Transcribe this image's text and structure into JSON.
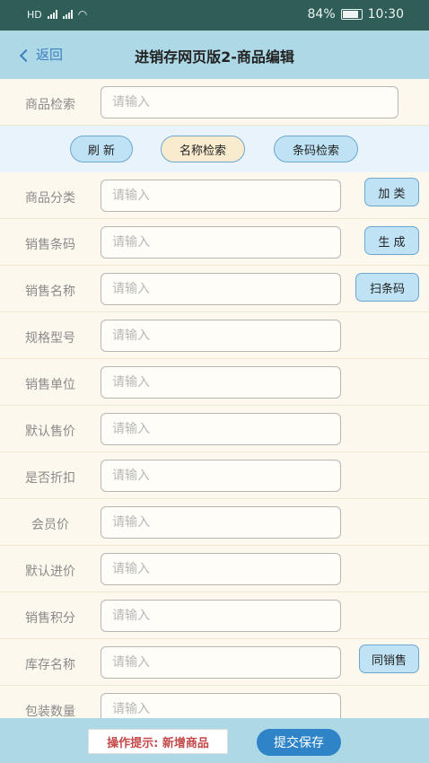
{
  "status": {
    "left": "HD",
    "battery": "84%",
    "time": "10:30"
  },
  "nav": {
    "back": "返回",
    "title": "进销存网页版2-商品编辑"
  },
  "search": {
    "label": "商品检索",
    "placeholder": "请输入"
  },
  "actions": {
    "refresh": "刷 新",
    "name_search": "名称检索",
    "barcode_search": "条码检索"
  },
  "fields": [
    {
      "label": "商品分类",
      "placeholder": "请输入"
    },
    {
      "label": "销售条码",
      "placeholder": "请输入"
    },
    {
      "label": "销售名称",
      "placeholder": "请输入"
    },
    {
      "label": "规格型号",
      "placeholder": "请输入"
    },
    {
      "label": "销售单位",
      "placeholder": "请输入"
    },
    {
      "label": "默认售价",
      "placeholder": "请输入"
    },
    {
      "label": "是否折扣",
      "placeholder": "请输入"
    },
    {
      "label": "会员价",
      "placeholder": "请输入"
    },
    {
      "label": "默认进价",
      "placeholder": "请输入"
    },
    {
      "label": "销售积分",
      "placeholder": "请输入"
    },
    {
      "label": "库存名称",
      "placeholder": "请输入"
    },
    {
      "label": "包装数量",
      "placeholder": "请输入"
    }
  ],
  "side_buttons": {
    "add_category": "加 类",
    "generate": "生 成",
    "scan": "扫条码",
    "same_as_sale": "同销售"
  },
  "footer": {
    "tip": "操作提示: 新增商品",
    "submit": "提交保存"
  }
}
